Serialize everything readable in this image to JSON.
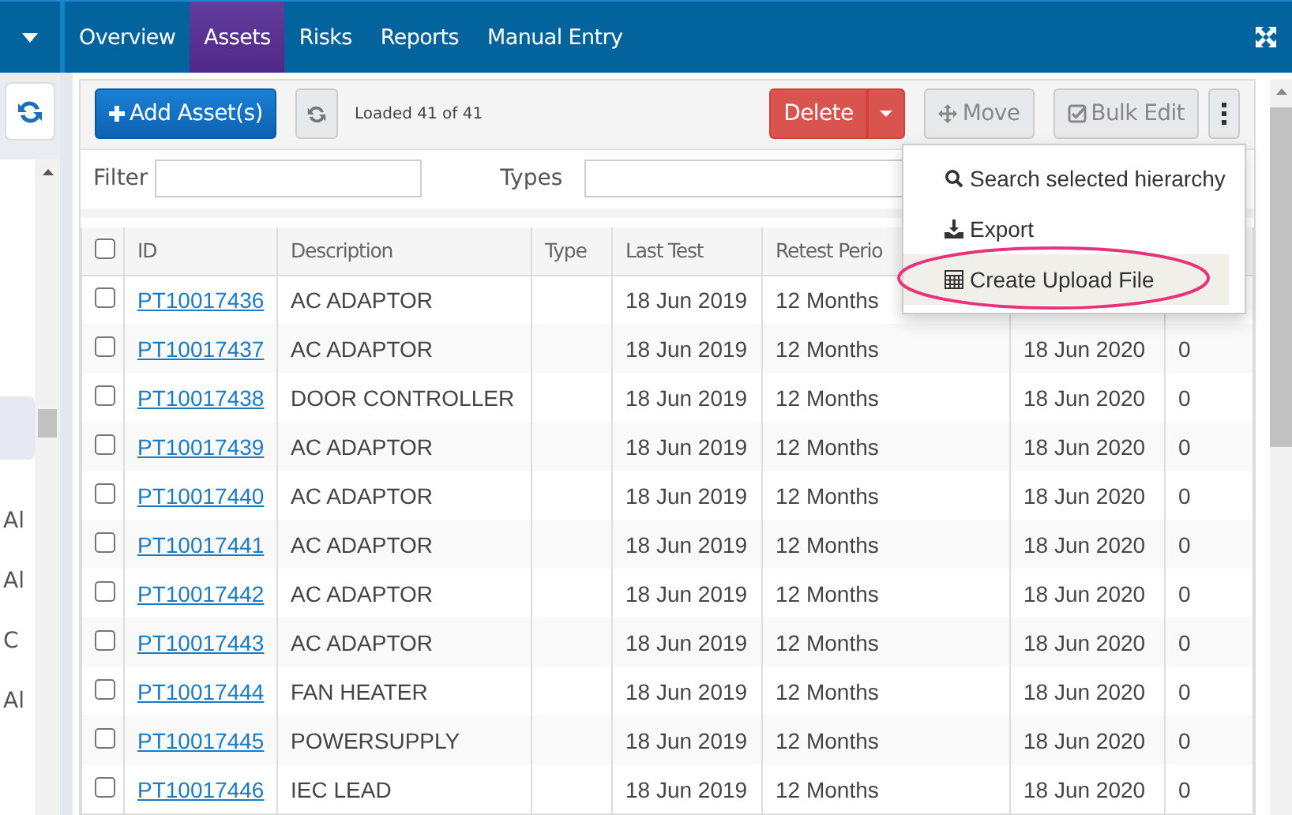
{
  "nav": {
    "tabs": [
      {
        "label": "Overview",
        "selected": false
      },
      {
        "label": "Assets",
        "selected": true
      },
      {
        "label": "Risks",
        "selected": false
      },
      {
        "label": "Reports",
        "selected": false
      },
      {
        "label": "Manual Entry",
        "selected": false
      }
    ]
  },
  "sidebar": {
    "items": [
      {
        "label": "Al"
      },
      {
        "label": "Al"
      },
      {
        "label": "C"
      },
      {
        "label": "Al"
      }
    ]
  },
  "toolbar": {
    "add_button": "Add Asset(s)",
    "status": "Loaded 41 of 41",
    "delete_button": "Delete",
    "move_button": "Move",
    "bulk_edit_button": "Bulk Edit"
  },
  "filters": {
    "filter_label": "Filter",
    "types_label": "Types"
  },
  "menu": {
    "items": [
      {
        "label": "Search selected hierarchy",
        "kind": "search",
        "highlighted": false
      },
      {
        "label": "Export",
        "kind": "export",
        "highlighted": false
      },
      {
        "label": "Create Upload File",
        "kind": "spreadsheet",
        "highlighted": true
      }
    ]
  },
  "table": {
    "select_all_checked": false,
    "columns": [
      "ID",
      "Description",
      "Type",
      "Last Test",
      "Retest Perio"
    ],
    "rows": [
      {
        "checked": false,
        "cells": [
          "PT10017436",
          "AC ADAPTOR",
          "",
          "18 Jun 2019",
          "12 Months"
        ]
      },
      {
        "checked": false,
        "cells": [
          "PT10017437",
          "AC ADAPTOR",
          "",
          "18 Jun 2019",
          "12 Months",
          "18 Jun 2020",
          "0"
        ]
      },
      {
        "checked": false,
        "cells": [
          "PT10017438",
          "DOOR CONTROLLER",
          "",
          "18 Jun 2019",
          "12 Months",
          "18 Jun 2020",
          "0"
        ]
      },
      {
        "checked": false,
        "cells": [
          "PT10017439",
          "AC ADAPTOR",
          "",
          "18 Jun 2019",
          "12 Months",
          "18 Jun 2020",
          "0"
        ]
      },
      {
        "checked": false,
        "cells": [
          "PT10017440",
          "AC ADAPTOR",
          "",
          "18 Jun 2019",
          "12 Months",
          "18 Jun 2020",
          "0"
        ]
      },
      {
        "checked": false,
        "cells": [
          "PT10017441",
          "AC ADAPTOR",
          "",
          "18 Jun 2019",
          "12 Months",
          "18 Jun 2020",
          "0"
        ]
      },
      {
        "checked": false,
        "cells": [
          "PT10017442",
          "AC ADAPTOR",
          "",
          "18 Jun 2019",
          "12 Months",
          "18 Jun 2020",
          "0"
        ]
      },
      {
        "checked": false,
        "cells": [
          "PT10017443",
          "AC ADAPTOR",
          "",
          "18 Jun 2019",
          "12 Months",
          "18 Jun 2020",
          "0"
        ]
      },
      {
        "checked": false,
        "cells": [
          "PT10017444",
          "FAN HEATER",
          "",
          "18 Jun 2019",
          "12 Months",
          "18 Jun 2020",
          "0"
        ]
      },
      {
        "checked": false,
        "cells": [
          "PT10017445",
          "POWERSUPPLY",
          "",
          "18 Jun 2019",
          "12 Months",
          "18 Jun 2020",
          "0"
        ]
      },
      {
        "checked": false,
        "cells": [
          "PT10017446",
          "IEC LEAD",
          "",
          "18 Jun 2019",
          "12 Months",
          "18 Jun 2020",
          "0"
        ]
      }
    ]
  }
}
